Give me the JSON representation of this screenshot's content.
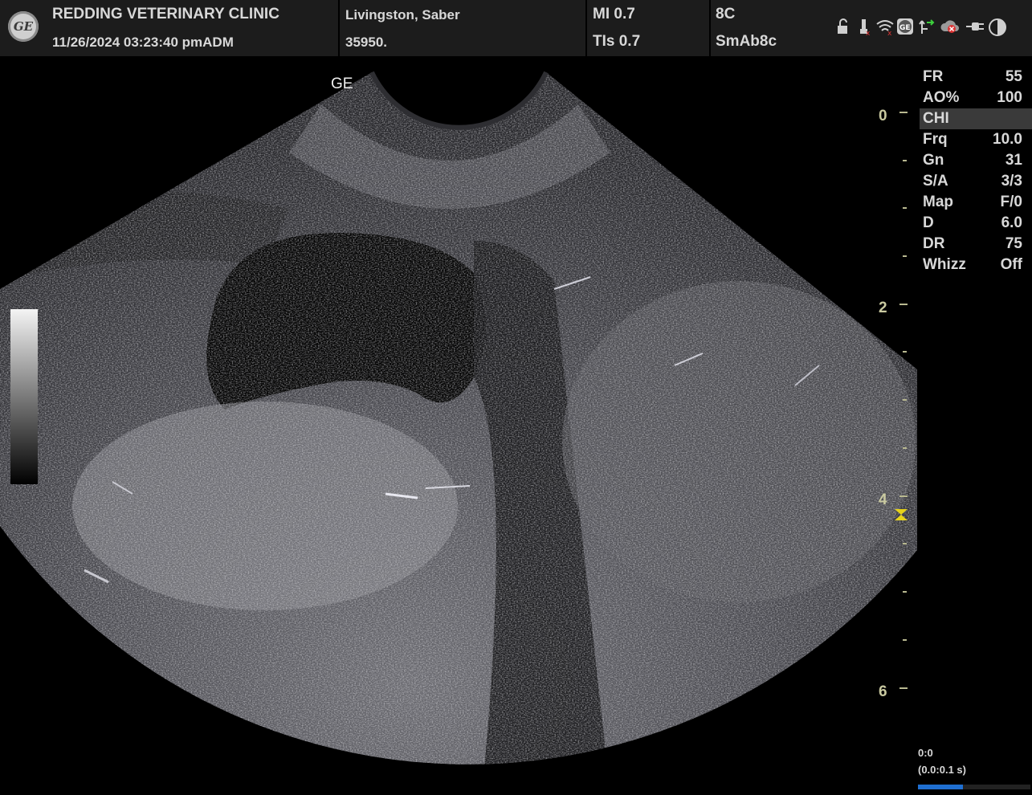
{
  "header": {
    "clinic": "REDDING VETERINARY CLINIC",
    "datetime": "11/26/2024  03:23:40 pmADM",
    "patient_name": "Livingston, Saber",
    "patient_id": "35950.",
    "mi": "MI 0.7",
    "tis": "TIs 0.7",
    "probe": "8C",
    "preset": "SmAb8c",
    "status_icons": [
      "lock-icon",
      "usb-icon",
      "wifi-icon",
      "ge-badge-icon",
      "network-icon",
      "cloud-icon",
      "plug-icon",
      "contrast-icon"
    ]
  },
  "image": {
    "probe_label": "GE",
    "depth_labels": [
      "0",
      "2",
      "4",
      "6"
    ]
  },
  "params": [
    {
      "key": "FR",
      "value": "55"
    },
    {
      "key": "AO%",
      "value": "100"
    },
    {
      "key": "CHI",
      "value": ""
    },
    {
      "key": "Frq",
      "value": "10.0"
    },
    {
      "key": "Gn",
      "value": "31"
    },
    {
      "key": "S/A",
      "value": "3/3"
    },
    {
      "key": "Map",
      "value": "F/0"
    },
    {
      "key": "D",
      "value": "6.0"
    },
    {
      "key": "DR",
      "value": "75"
    },
    {
      "key": "Whizz",
      "value": "Off"
    }
  ],
  "cine": {
    "frame": "0:0",
    "range": "(0.0:0.1 s)",
    "progress_fraction": 0.4
  },
  "colors": {
    "accent_blue": "#1f6fd1",
    "focus_marker": "#e6d21a",
    "depth_label": "#c9c9a0"
  }
}
